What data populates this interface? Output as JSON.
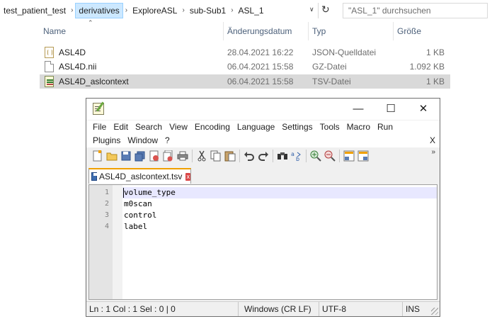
{
  "explorer": {
    "breadcrumb": [
      "test_patient_test",
      "derivatives",
      "ExploreASL",
      "sub-Sub1",
      "ASL_1"
    ],
    "breadcrumb_active_index": 1,
    "search_placeholder": "\"ASL_1\" durchsuchen",
    "columns": {
      "name": "Name",
      "date": "Änderungsdatum",
      "type": "Typ",
      "size": "Größe"
    },
    "files": [
      {
        "name": "ASL4D",
        "date": "28.04.2021 16:22",
        "type": "JSON-Quelldatei",
        "size": "1 KB",
        "icon": "json-file-icon"
      },
      {
        "name": "ASL4D.nii",
        "date": "06.04.2021 15:58",
        "type": "GZ-Datei",
        "size": "1.092 KB",
        "icon": "gz-file-icon"
      },
      {
        "name": "ASL4D_aslcontext",
        "date": "06.04.2021 15:58",
        "type": "TSV-Datei",
        "size": "1 KB",
        "icon": "tsv-file-icon",
        "selected": true
      }
    ]
  },
  "notepad": {
    "window_controls": {
      "minimize": "—",
      "maximize": "☐",
      "close": "✕"
    },
    "menu_row1": [
      "File",
      "Edit",
      "Search",
      "View",
      "Encoding",
      "Language",
      "Settings",
      "Tools",
      "Macro",
      "Run"
    ],
    "menu_row2": [
      "Plugins",
      "Window",
      "?"
    ],
    "close_doc": "X",
    "tab_label": "ASL4D_aslcontext.tsv",
    "tab_close": "x",
    "lines": [
      {
        "num": "1",
        "text": "volume_type"
      },
      {
        "num": "2",
        "text": "m0scan"
      },
      {
        "num": "3",
        "text": "control"
      },
      {
        "num": "4",
        "text": "label"
      }
    ],
    "status": {
      "position": "Ln : 1    Col : 1    Sel : 0 | 0",
      "eol": "Windows (CR LF)",
      "encoding": "UTF-8",
      "mode": "INS"
    },
    "toolbar_overflow": "»"
  }
}
